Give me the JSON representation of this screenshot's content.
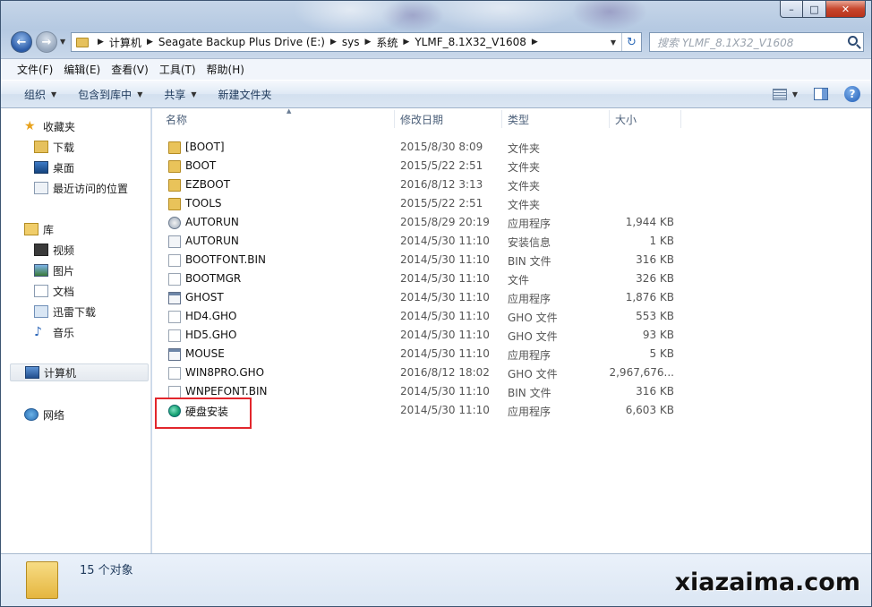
{
  "window": {
    "caption_buttons": {
      "minimize": "–",
      "maximize": "□",
      "close": "✕"
    }
  },
  "navigation": {
    "back_icon": "arrow-left-icon",
    "forward_icon": "arrow-right-icon",
    "breadcrumbs": [
      "计算机",
      "Seagate Backup Plus Drive (E:)",
      "sys",
      "系统",
      "YLMF_8.1X32_V1608"
    ],
    "search_placeholder": "搜索 YLMF_8.1X32_V1608"
  },
  "menubar": [
    "文件(F)",
    "编辑(E)",
    "查看(V)",
    "工具(T)",
    "帮助(H)"
  ],
  "commandbar": {
    "organize": "组织",
    "include_in_library": "包含到库中",
    "share": "共享",
    "new_folder": "新建文件夹"
  },
  "navpane": {
    "favorites": {
      "label": "收藏夹",
      "items": [
        "下载",
        "桌面",
        "最近访问的位置"
      ]
    },
    "libraries": {
      "label": "库",
      "items": [
        "视频",
        "图片",
        "文档",
        "迅雷下载",
        "音乐"
      ]
    },
    "computer": "计算机",
    "network": "网络"
  },
  "columns": {
    "name": "名称",
    "date": "修改日期",
    "type": "类型",
    "size": "大小"
  },
  "files": [
    {
      "name": "[BOOT]",
      "date": "2015/8/30 8:09",
      "type": "文件夹",
      "size": "",
      "icon": "folder-icon"
    },
    {
      "name": "BOOT",
      "date": "2015/5/22 2:51",
      "type": "文件夹",
      "size": "",
      "icon": "folder-icon"
    },
    {
      "name": "EZBOOT",
      "date": "2016/8/12 3:13",
      "type": "文件夹",
      "size": "",
      "icon": "folder-icon"
    },
    {
      "name": "TOOLS",
      "date": "2015/5/22 2:51",
      "type": "文件夹",
      "size": "",
      "icon": "folder-icon"
    },
    {
      "name": "AUTORUN",
      "date": "2015/8/29 20:19",
      "type": "应用程序",
      "size": "1,944 KB",
      "icon": "autorun-app-icon"
    },
    {
      "name": "AUTORUN",
      "date": "2014/5/30 11:10",
      "type": "安装信息",
      "size": "1 KB",
      "icon": "setup-info-icon"
    },
    {
      "name": "BOOTFONT.BIN",
      "date": "2014/5/30 11:10",
      "type": "BIN 文件",
      "size": "316 KB",
      "icon": "file-icon"
    },
    {
      "name": "BOOTMGR",
      "date": "2014/5/30 11:10",
      "type": "文件",
      "size": "326 KB",
      "icon": "file-icon"
    },
    {
      "name": "GHOST",
      "date": "2014/5/30 11:10",
      "type": "应用程序",
      "size": "1,876 KB",
      "icon": "application-icon"
    },
    {
      "name": "HD4.GHO",
      "date": "2014/5/30 11:10",
      "type": "GHO 文件",
      "size": "553 KB",
      "icon": "file-icon"
    },
    {
      "name": "HD5.GHO",
      "date": "2014/5/30 11:10",
      "type": "GHO 文件",
      "size": "93 KB",
      "icon": "file-icon"
    },
    {
      "name": "MOUSE",
      "date": "2014/5/30 11:10",
      "type": "应用程序",
      "size": "5 KB",
      "icon": "application-icon"
    },
    {
      "name": "WIN8PRO.GHO",
      "date": "2016/8/12 18:02",
      "type": "GHO 文件",
      "size": "2,967,676...",
      "icon": "file-icon"
    },
    {
      "name": "WNPEFONT.BIN",
      "date": "2014/5/30 11:10",
      "type": "BIN 文件",
      "size": "316 KB",
      "icon": "file-icon"
    },
    {
      "name": "硬盘安装",
      "date": "2014/5/30 11:10",
      "type": "应用程序",
      "size": "6,603 KB",
      "icon": "disk-installer-icon"
    }
  ],
  "highlight_color": "#e2262c",
  "status": {
    "count": "15 个对象"
  },
  "watermark": "xiazaima.com"
}
